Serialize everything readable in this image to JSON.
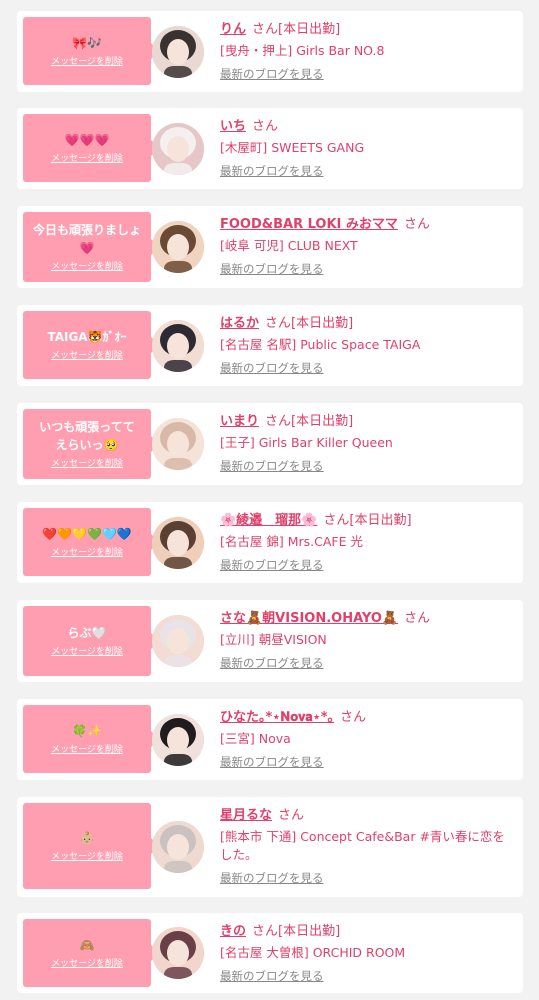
{
  "delete_label": "メッセージを削除",
  "honorific": "さん",
  "blog_label": "最新のブログを見る",
  "colors": {
    "accent": "#e0406a",
    "bubble": "#ff9eb0"
  },
  "entries": [
    {
      "message": "🎀🎶",
      "name": "りん",
      "status": "[本日出勤]",
      "shop": "[曳舟・押上] Girls Bar NO.8"
    },
    {
      "message": "💗💗💗",
      "name": "いち",
      "status": "",
      "shop": "[木屋町] SWEETS GANG"
    },
    {
      "message": "今日も頑張りましょ💗",
      "name": "FOOD&BAR LOKI みおママ",
      "status": "",
      "shop": "[岐阜 可児] CLUB NEXT"
    },
    {
      "message": "TAIGA🐯ｶﾞｵｰ",
      "name": "はるか",
      "status": "[本日出勤]",
      "shop": "[名古屋 名駅] Public Space TAIGA"
    },
    {
      "message": "いつも頑張ってて\nえらいっ🥺",
      "name": "いまり",
      "status": "[本日出勤]",
      "shop": "[王子] Girls Bar Killer Queen"
    },
    {
      "message": "❤️🧡💛💚🩵💙",
      "name": "🌸綾邉　瑠那🌸",
      "status": "[本日出勤]",
      "shop": "[名古屋 錦] Mrs.CAFE 光"
    },
    {
      "message": "らぶ🤍",
      "name": "さな🧸朝VISION.OHAYO🧸",
      "status": "",
      "shop": "[立川] 朝昼VISION"
    },
    {
      "message": "🍀✨",
      "name": "ひなた｡*⋆𝐍𝐨𝐯𝐚⋆*｡",
      "status": "",
      "shop": "[三宮] Nova"
    },
    {
      "message": "👶🏼",
      "name": "星月るな",
      "status": "",
      "shop": "[熊本市 下通] Concept Cafe&Bar #青い春に恋をした。"
    },
    {
      "message": "🙈",
      "name": "きの",
      "status": "[本日出勤]",
      "shop": "[名古屋 大曽根] ORCHID ROOM"
    }
  ]
}
